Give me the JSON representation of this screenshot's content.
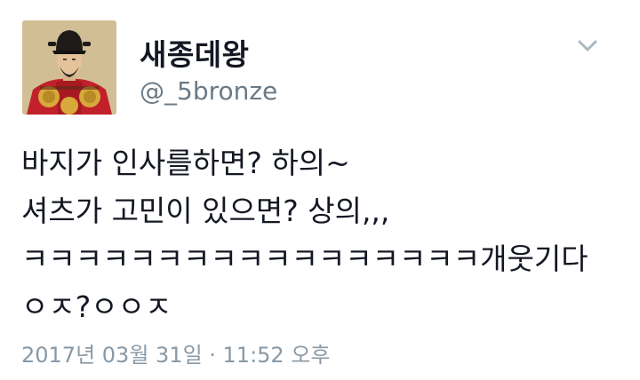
{
  "author": {
    "display_name": "새종데왕",
    "handle": "@_5bronze",
    "avatar_icon": "king-portrait-avatar"
  },
  "menu": {
    "icon": "chevron-down-icon"
  },
  "tweet": {
    "lines": [
      "바지가 인사를하면? 하의~",
      "셔츠가 고민이 있으면? 상의,,,",
      "ㅋㅋㅋㅋㅋㅋㅋㅋㅋㅋㅋㅋㅋㅋㅋㅋㅋ개웃기다",
      "ㅇㅈ?ㅇㅇㅈ"
    ],
    "timestamp": "2017년 03월 31일 · 11:52 오후"
  },
  "colors": {
    "text": "#141823",
    "secondary": "#6b7a86",
    "timestamp": "#8899a6"
  }
}
